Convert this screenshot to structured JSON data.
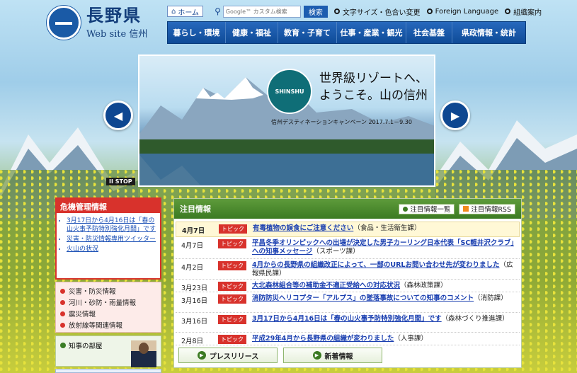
{
  "logo": {
    "title": "長野県",
    "sub": "Web site 信州"
  },
  "util": {
    "home": "ホーム",
    "search_placeholder": "Google™ カスタム検索",
    "search_button": "検索",
    "links": [
      "文字サイズ・色合い変更",
      "Foreign Language",
      "組織案内"
    ]
  },
  "gnav": [
    "暮らし・環境",
    "健康・福祉",
    "教育・子育て",
    "仕事・産業・観光",
    "社会基盤",
    "県政情報・統計"
  ],
  "slide": {
    "badge": "SHINSHU",
    "headline1": "世界級リゾートへ、",
    "headline2": "ようこそ。山の信州",
    "caption": "信州デスティネーションキャンペーン 2017.7.1－9.30",
    "stop": "II STOP",
    "prev": "◀",
    "next": "▶"
  },
  "crisis": {
    "title": "危機管理情報",
    "items": [
      "3月17日から4月16日は「春の山火事予防特別強化月間」です",
      "災害・防災情報専用ツイッター",
      "火山の状況"
    ]
  },
  "categories": [
    "災害・防災情報",
    "河川・砂防・雨量情報",
    "震災情報",
    "放射線等関連情報"
  ],
  "governor": {
    "label": "知事の部屋"
  },
  "news": {
    "title": "注目情報",
    "btn_list": "注目情報一覧",
    "btn_rss": "注目情報RSS",
    "rows": [
      {
        "date": "4月7日",
        "tag": "トピック",
        "link": "有毒植物の誤食にご注意ください",
        "note": "（食品・生活衛生課）"
      },
      {
        "date": "4月7日",
        "tag": "トピック",
        "link": "平昌冬季オリンピックへの出場が決定した男子カーリング日本代表「SC軽井沢クラブ」への知事メッセージ",
        "note": "（スポーツ課）"
      },
      {
        "date": "4月2日",
        "tag": "トピック",
        "link": "4月からの長野県の組織改正によって、一部のURLお問い合わせ先が変わりました",
        "note": "（広報県民課）"
      },
      {
        "date": "3月23日",
        "tag": "トピック",
        "link": "大北森林組合等の補助金不適正受給への対応状況",
        "note": "（森林政策課）"
      },
      {
        "date": "3月16日",
        "tag": "トピック",
        "link": "消防防災ヘリコプター「アルプス」の墜落事故についての知事のコメント",
        "note": "（消防課）"
      },
      {
        "date": "3月16日",
        "tag": "トピック",
        "link": "3月17日から4月16日は「春の山火事予防特別強化月間」です",
        "note": "（森林づくり推進課）"
      },
      {
        "date": "2月8日",
        "tag": "トピック",
        "link": "平成29年4月から長野県の組織が変わりました",
        "note": "（人事課）"
      }
    ],
    "foot_press": "プレスリリース",
    "foot_new": "新着情報"
  }
}
